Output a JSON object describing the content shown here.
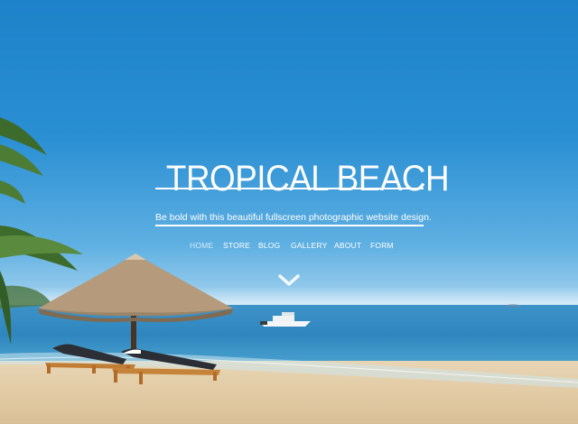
{
  "hero": {
    "title": "TROPICAL BEACH",
    "tagline": "Be bold with this beautiful fullscreen photographic website design."
  },
  "nav": {
    "items": [
      {
        "label": "HOME",
        "active": true
      },
      {
        "label": "STORE",
        "active": false
      },
      {
        "label": "BLOG",
        "active": false
      },
      {
        "label": "GALLERY",
        "active": false
      },
      {
        "label": "ABOUT",
        "active": false
      },
      {
        "label": "FORM",
        "active": false
      }
    ]
  },
  "scroll": {
    "icon": "chevron-down-icon"
  },
  "colors": {
    "text": "#ffffff",
    "sky": "#2a8fd3",
    "sea": "#3d93c8",
    "sand": "#e2cba5"
  }
}
